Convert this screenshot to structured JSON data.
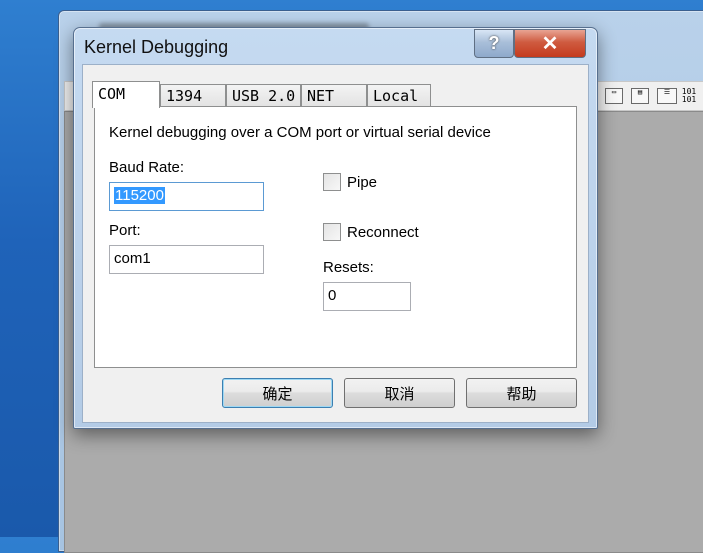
{
  "dialog": {
    "title": "Kernel Debugging",
    "help_glyph": "?",
    "close_glyph": "✕"
  },
  "tabs": [
    {
      "label": "COM",
      "active": true
    },
    {
      "label": "1394",
      "active": false
    },
    {
      "label": "USB 2.0",
      "active": false
    },
    {
      "label": "NET",
      "active": false
    },
    {
      "label": "Local",
      "active": false
    }
  ],
  "com": {
    "description": "Kernel debugging over a COM port or virtual serial device",
    "baud_rate": {
      "label": "Baud Rate:",
      "value": "115200"
    },
    "port": {
      "label": "Port:",
      "value": "com1"
    },
    "pipe": {
      "label": "Pipe",
      "checked": false
    },
    "reconnect": {
      "label": "Reconnect",
      "checked": false
    },
    "resets": {
      "label": "Resets:",
      "value": "0"
    }
  },
  "buttons": {
    "ok": "确定",
    "cancel": "取消",
    "help": "帮助"
  },
  "background_toolbar": {
    "icon_binary": "101\n101"
  }
}
